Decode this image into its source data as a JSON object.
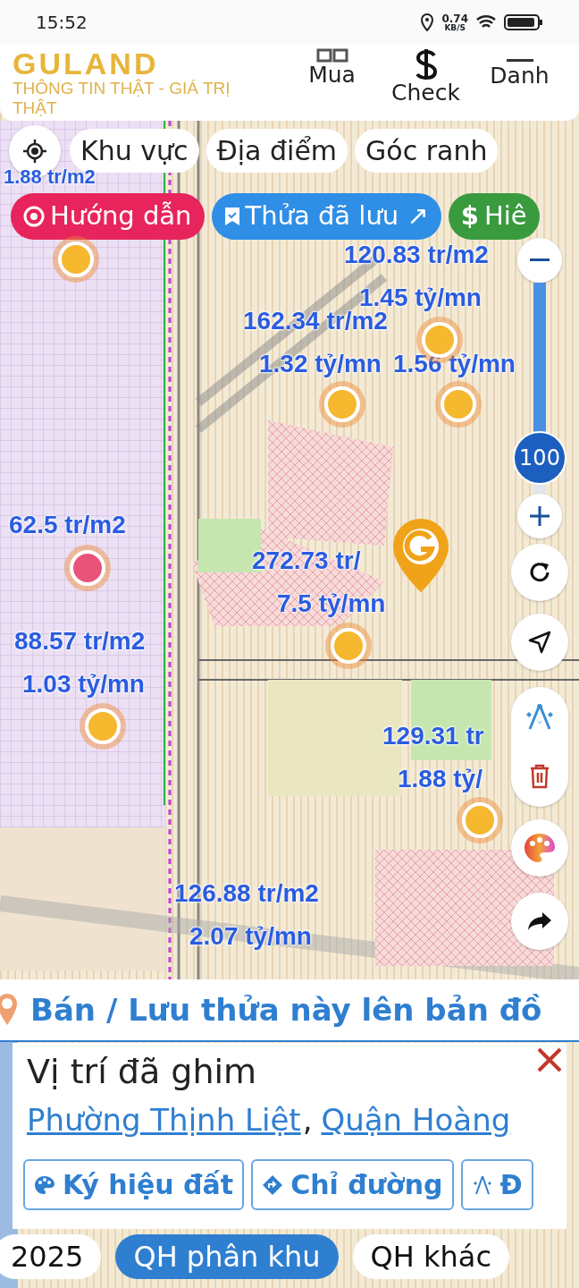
{
  "status_bar": {
    "time": "15:52",
    "net_speed": "0.74",
    "net_unit": "KB/S"
  },
  "header": {
    "logo": "GULAND",
    "tagline": "THÔNG TIN THẬT - GIÁ TRỊ THẬT",
    "nav": [
      {
        "label": "Mua",
        "kind": "grid"
      },
      {
        "label": "Check",
        "kind": "dollar"
      },
      {
        "label": "Danh",
        "kind": "menu"
      }
    ]
  },
  "filter_chips": [
    {
      "label": "Khu vực"
    },
    {
      "label": "Địa điểm"
    },
    {
      "label": "Góc ranh"
    }
  ],
  "action_chips": [
    {
      "label": "Hướng dẫn",
      "kind": "guide",
      "color": "#e8245c"
    },
    {
      "label": "Thửa đã lưu ↗",
      "kind": "saved",
      "color": "#2f8ee6"
    },
    {
      "label": "Hiê",
      "kind": "price",
      "icon": "$",
      "color": "#3a9a3e"
    }
  ],
  "map": {
    "labels": [
      {
        "text": "1.88 tr/m2"
      },
      {
        "text": "120.83 tr/m2"
      },
      {
        "text": "1.45 tỷ/mn"
      },
      {
        "text": "162.34 tr/m2"
      },
      {
        "text": "1.32 tỷ/mn"
      },
      {
        "text": "1.56 tỷ/mn"
      },
      {
        "text": "62.5 tr/m2"
      },
      {
        "text": "272.73 tr/"
      },
      {
        "text": "7.5 tỷ/mn"
      },
      {
        "text": "88.57 tr/m2"
      },
      {
        "text": "1.03 tỷ/mn"
      },
      {
        "text": "129.31 tr"
      },
      {
        "text": "1.88 tỷ/"
      },
      {
        "text": "126.88 tr/m2"
      },
      {
        "text": "2.07 tỷ/mn"
      }
    ],
    "pins": [
      {
        "color": "#f5b82e"
      },
      {
        "color": "#f5b82e"
      },
      {
        "color": "#f5b82e"
      },
      {
        "color": "#f5b82e"
      },
      {
        "color": "#e8537a"
      },
      {
        "color": "#f5b82e"
      },
      {
        "color": "#f5b82e"
      },
      {
        "color": "#f5b82e"
      }
    ]
  },
  "zoom": {
    "level": 0.83,
    "value": "100"
  },
  "banner": {
    "text": "Bán / Lưu thửa này lên bản đồ"
  },
  "place_card": {
    "title": "Vị trí đã ghim",
    "address": [
      {
        "text": "Phường Thịnh Liệt"
      },
      {
        "text": "Quận Hoàng"
      }
    ],
    "separator": ",",
    "buttons": [
      {
        "label": "Ký hiệu đất",
        "kind": "palette"
      },
      {
        "label": "Chỉ đường",
        "kind": "directions"
      },
      {
        "label": "Đ",
        "kind": "compass"
      }
    ]
  },
  "layer_tabs": [
    {
      "label": "2025",
      "selected": false
    },
    {
      "label": "QH phân khu",
      "selected": true
    },
    {
      "label": "QH khác",
      "selected": false
    }
  ]
}
